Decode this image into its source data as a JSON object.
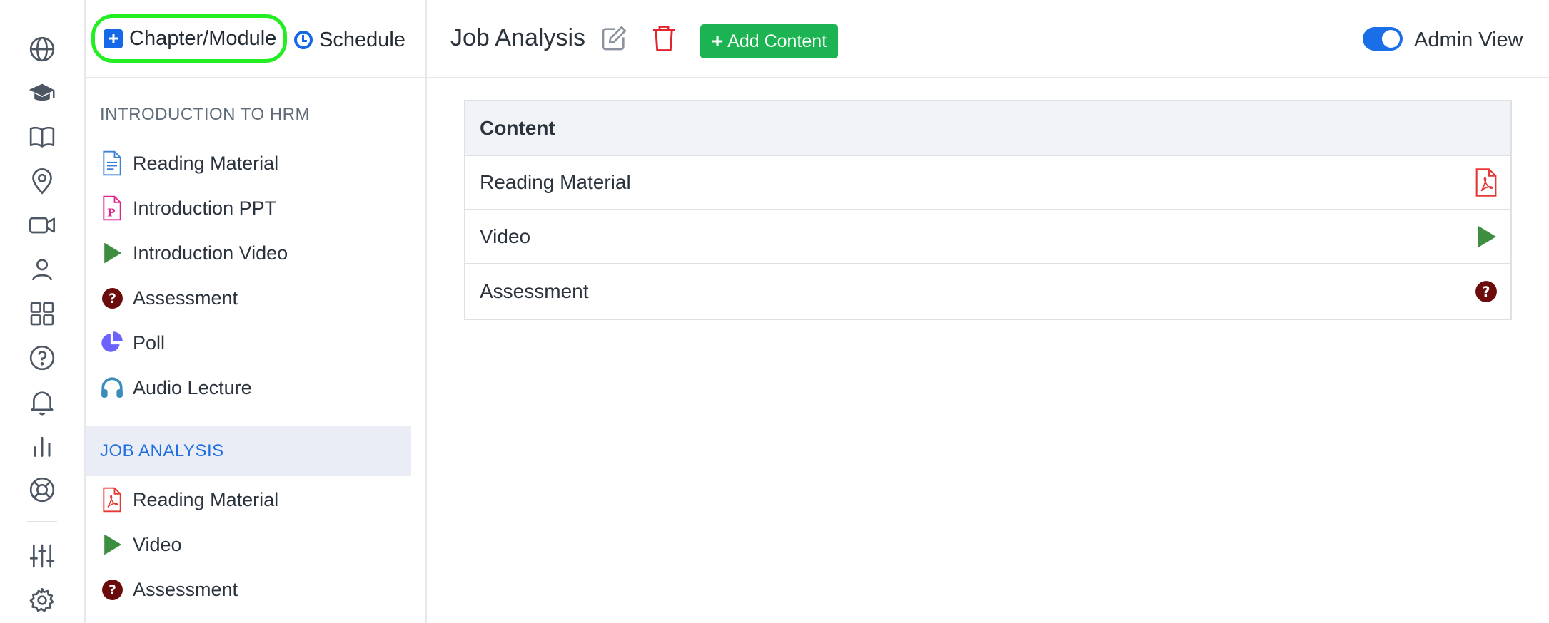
{
  "toolbar": {
    "chapter_module_label": "Chapter/Module",
    "schedule_label": "Schedule"
  },
  "rail_icons": [
    "globe-icon",
    "graduation-cap-icon",
    "book-icon",
    "map-pin-icon",
    "video-camera-icon",
    "user-icon",
    "grid-icon",
    "help-circle-icon",
    "bell-icon",
    "bar-chart-icon",
    "lifebuoy-icon",
    "sliders-icon",
    "settings-icon"
  ],
  "chapters": [
    {
      "title": "INTRODUCTION TO HRM",
      "active": false,
      "items": [
        {
          "label": "Reading Material",
          "icon": "document-icon"
        },
        {
          "label": "Introduction PPT",
          "icon": "ppt-icon"
        },
        {
          "label": "Introduction Video",
          "icon": "play-icon"
        },
        {
          "label": "Assessment",
          "icon": "question-icon"
        },
        {
          "label": "Poll",
          "icon": "pie-chart-icon"
        },
        {
          "label": "Audio Lecture",
          "icon": "headphones-icon"
        }
      ]
    },
    {
      "title": "JOB ANALYSIS",
      "active": true,
      "items": [
        {
          "label": "Reading Material",
          "icon": "pdf-icon"
        },
        {
          "label": "Video",
          "icon": "play-icon"
        },
        {
          "label": "Assessment",
          "icon": "question-icon"
        }
      ]
    }
  ],
  "main": {
    "title": "Job Analysis",
    "add_content_label": "Add Content",
    "admin_view_label": "Admin View",
    "admin_view_on": true,
    "table": {
      "header": "Content",
      "rows": [
        {
          "label": "Reading Material",
          "icon": "pdf-icon"
        },
        {
          "label": "Video",
          "icon": "play-icon"
        },
        {
          "label": "Assessment",
          "icon": "question-icon"
        }
      ]
    }
  },
  "colors": {
    "accent_blue": "#1568e8",
    "highlight_green": "#22ee22",
    "add_button_green": "#1cb352",
    "delete_red": "#e2242e",
    "play_green": "#3e8e41",
    "question_maroon": "#6b0b0b",
    "pdf_red": "#e53935",
    "ppt_pink": "#e0248c",
    "poll_purple": "#6c63ff",
    "audio_teal": "#3a8dbb",
    "active_chapter_bg": "#eaedf6"
  }
}
